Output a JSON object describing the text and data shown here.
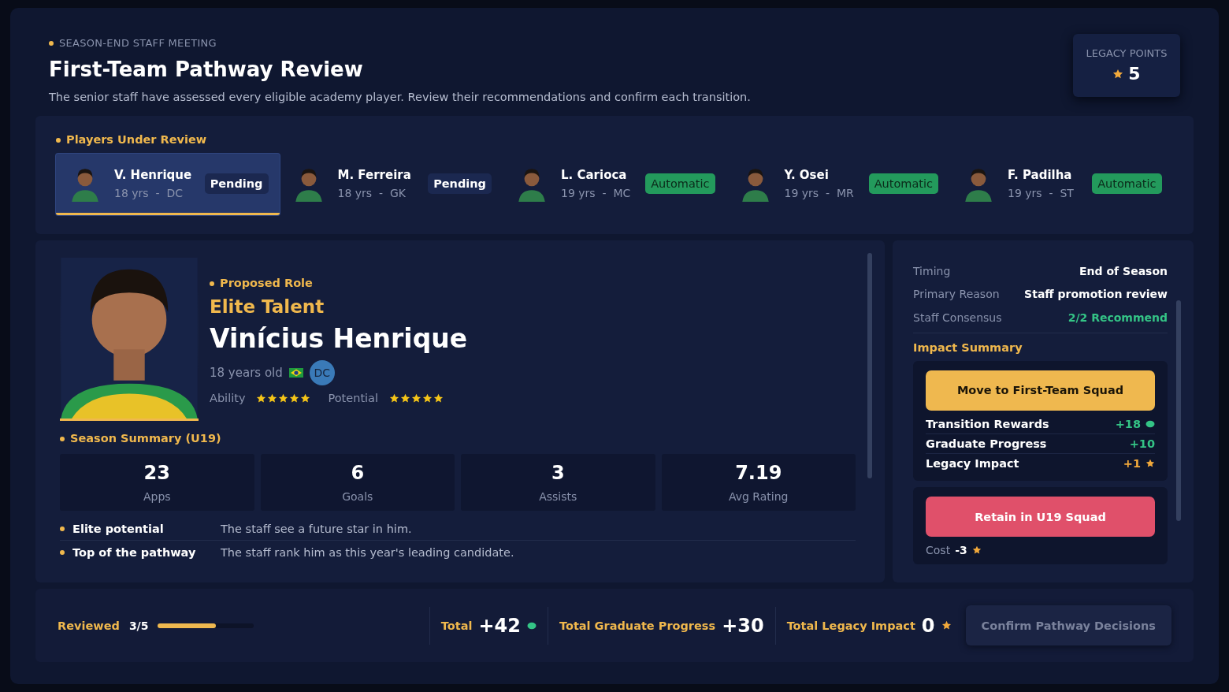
{
  "header": {
    "eyebrow": "SEASON-END STAFF MEETING",
    "title": "First-Team Pathway Review",
    "subtitle": "The senior staff have assessed every eligible academy player. Review their recommendations and confirm each transition.",
    "legacy": {
      "label": "LEGACY POINTS",
      "value": "5"
    }
  },
  "players_panel": {
    "title": "Players Under Review",
    "players": [
      {
        "name": "V. Henrique",
        "meta": "18 yrs  -  DC",
        "status": "Pending",
        "kind": "pending",
        "selected": true
      },
      {
        "name": "M. Ferreira",
        "meta": "18 yrs  -  GK",
        "status": "Pending",
        "kind": "pending",
        "selected": false
      },
      {
        "name": "L. Carioca",
        "meta": "19 yrs  -  MC",
        "status": "Automatic",
        "kind": "automatic",
        "selected": false
      },
      {
        "name": "Y. Osei",
        "meta": "19 yrs  -  MR",
        "status": "Automatic",
        "kind": "automatic",
        "selected": false
      },
      {
        "name": "F. Padilha",
        "meta": "19 yrs  -  ST",
        "status": "Automatic",
        "kind": "automatic",
        "selected": false
      }
    ]
  },
  "profile": {
    "role_heading": "Proposed Role",
    "role": "Elite Talent",
    "name": "Vinícius Henrique",
    "age": "18 years old",
    "position": "DC",
    "ratings": [
      {
        "label": "Ability",
        "stars": 5
      },
      {
        "label": "Potential",
        "stars": 5
      }
    ],
    "summary_heading": "Season Summary (U19)",
    "stats": [
      {
        "value": "23",
        "label": "Apps"
      },
      {
        "value": "6",
        "label": "Goals"
      },
      {
        "value": "3",
        "label": "Assists"
      },
      {
        "value": "7.19",
        "label": "Avg Rating"
      }
    ],
    "notes": [
      {
        "label": "Elite potential",
        "text": "The staff see a future star in him."
      },
      {
        "label": "Top of the pathway",
        "text": "The staff rank him as this year's leading candidate."
      }
    ]
  },
  "decision": {
    "details": [
      {
        "label": "Timing",
        "value": "End of Season",
        "kind": "plain"
      },
      {
        "label": "Primary Reason",
        "value": "Staff promotion review",
        "kind": "plain"
      },
      {
        "label": "Staff Consensus",
        "value": "2/2 Recommend",
        "kind": "positive"
      }
    ],
    "impact_heading": "Impact Summary",
    "options": [
      {
        "button": "Move to First-Team Squad",
        "kind": "primary",
        "effects": [
          {
            "label": "Transition Rewards",
            "value": "+18",
            "kind": "token"
          },
          {
            "label": "Graduate Progress",
            "value": "+10",
            "kind": "plain"
          },
          {
            "label": "Legacy Impact",
            "value": "+1",
            "kind": "star"
          }
        ]
      },
      {
        "button": "Retain in U19 Squad",
        "kind": "danger",
        "cost_label": "Cost",
        "cost": "-3"
      }
    ]
  },
  "footer": {
    "reviewed_label": "Reviewed",
    "reviewed": "3/5",
    "level": 0.6,
    "totals": [
      {
        "label": "Total",
        "value": "+42",
        "kind": "token"
      },
      {
        "label": "Total Graduate Progress",
        "value": "+30",
        "kind": "plain"
      },
      {
        "label": "Total Legacy Impact",
        "value": "0",
        "kind": "star"
      }
    ],
    "confirm": "Confirm Pathway Decisions",
    "disabled": true
  }
}
